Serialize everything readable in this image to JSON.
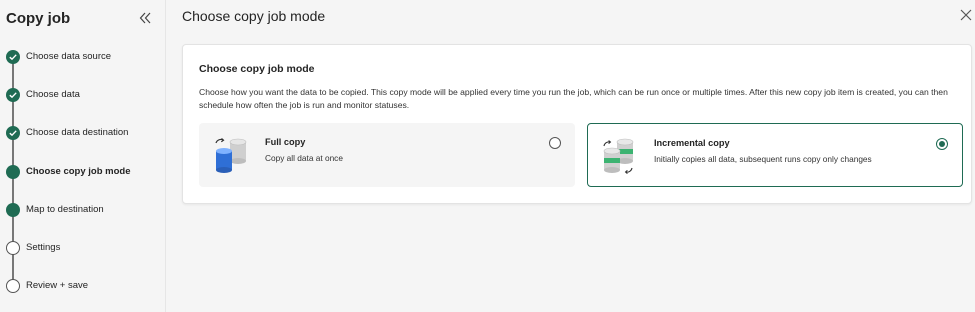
{
  "sidebar": {
    "title": "Copy job",
    "collapse_icon": "chevron-double-left-icon",
    "steps": [
      {
        "label": "Choose data source",
        "state": "done"
      },
      {
        "label": "Choose data",
        "state": "done"
      },
      {
        "label": "Choose data destination",
        "state": "done"
      },
      {
        "label": "Choose copy job mode",
        "state": "current"
      },
      {
        "label": "Map to destination",
        "state": "upcoming"
      },
      {
        "label": "Settings",
        "state": "upcoming"
      },
      {
        "label": "Review + save",
        "state": "upcoming"
      }
    ]
  },
  "header": {
    "title": "Choose copy job mode",
    "close_icon": "close-icon"
  },
  "panel": {
    "title": "Choose copy job mode",
    "description": "Choose how you want the data to be copied. This copy mode will be applied every time you run the job, which can be run once or multiple times. After this new copy job item is created, you can then schedule how often the job is run and monitor statuses.",
    "options": [
      {
        "title": "Full copy",
        "description": "Copy all data at once",
        "selected": false,
        "icon": "full-copy-database-icon"
      },
      {
        "title": "Incremental copy",
        "description": "Initially copies all data, subsequent runs copy only changes",
        "selected": true,
        "icon": "incremental-copy-database-icon"
      }
    ]
  },
  "colors": {
    "accent": "#1f6b53",
    "background": "#f5f5f5",
    "panel": "#ffffff"
  }
}
